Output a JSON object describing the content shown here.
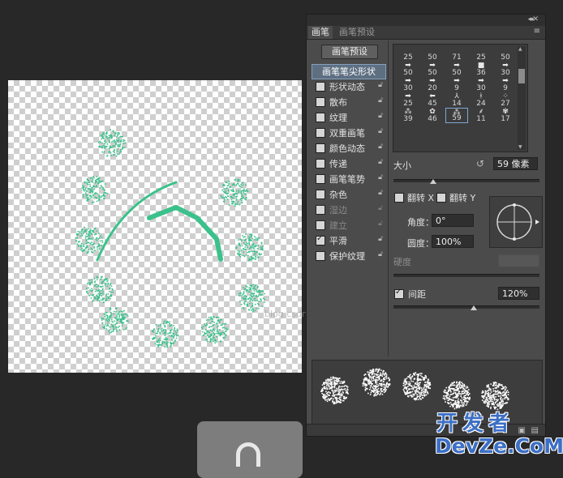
{
  "panel": {
    "tabs": [
      "画笔",
      "画笔预设"
    ],
    "brush_presets_button": "画笔预设",
    "options": [
      {
        "label": "画笔笔尖形状",
        "selected": true
      },
      {
        "label": "形状动态",
        "checked": false,
        "enabled": true
      },
      {
        "label": "散布",
        "checked": false,
        "enabled": true
      },
      {
        "label": "纹理",
        "checked": false,
        "enabled": true
      },
      {
        "label": "双重画笔",
        "checked": false,
        "enabled": true
      },
      {
        "label": "颜色动态",
        "checked": false,
        "enabled": true
      },
      {
        "label": "传递",
        "checked": false,
        "enabled": true
      },
      {
        "label": "画笔笔势",
        "checked": false,
        "enabled": true
      },
      {
        "label": "杂色",
        "checked": false,
        "enabled": true
      },
      {
        "label": "湿边",
        "checked": false,
        "enabled": false
      },
      {
        "label": "建立",
        "checked": false,
        "enabled": false
      },
      {
        "label": "平滑",
        "checked": true,
        "enabled": true
      },
      {
        "label": "保护纹理",
        "checked": false,
        "enabled": true
      }
    ],
    "brush_tips": [
      {
        "size": "25",
        "glyph": ""
      },
      {
        "size": "50",
        "glyph": ""
      },
      {
        "size": "71",
        "glyph": ""
      },
      {
        "size": "25",
        "glyph": ""
      },
      {
        "size": "50",
        "glyph": ""
      },
      {
        "size": "50",
        "glyph": "➡"
      },
      {
        "size": "50",
        "glyph": "➡"
      },
      {
        "size": "50",
        "glyph": "➡"
      },
      {
        "size": "36",
        "glyph": "■"
      },
      {
        "size": "30",
        "glyph": "➡"
      },
      {
        "size": "30",
        "glyph": "➡"
      },
      {
        "size": "20",
        "glyph": "➡"
      },
      {
        "size": "9",
        "glyph": "➡"
      },
      {
        "size": "30",
        "glyph": "➡"
      },
      {
        "size": "9",
        "glyph": "➡"
      },
      {
        "size": "25",
        "glyph": "➡"
      },
      {
        "size": "45",
        "glyph": "⬅"
      },
      {
        "size": "14",
        "glyph": "⅄"
      },
      {
        "size": "24",
        "glyph": "ᚼ"
      },
      {
        "size": "27",
        "glyph": "⁘"
      },
      {
        "size": "39",
        "glyph": "⁂"
      },
      {
        "size": "46",
        "glyph": "✿"
      },
      {
        "size": "59",
        "glyph": "⁂",
        "selected": true
      },
      {
        "size": "11",
        "glyph": "⸙"
      },
      {
        "size": "17",
        "glyph": "✾"
      }
    ],
    "size_label": "大小",
    "size_value": "59 像素",
    "flip_x": "翻转 X",
    "flip_y": "翻转 Y",
    "angle_label": "角度：",
    "angle_value": "0°",
    "roundness_label": "圆度：",
    "roundness_value": "100%",
    "hardness_label": "硬度",
    "spacing_label": "间距",
    "spacing_value": "120%",
    "spacing_checked": true,
    "size_slider_level": 0.27,
    "spacing_slider_level": 0.55
  },
  "canvas": {
    "watermark": "blog.csdn.net/wangzibgan"
  },
  "logo": {
    "line1": "开发者",
    "line2": "DevZe.CoM"
  },
  "colors": {
    "stroke": "#3bc18b",
    "panel_bg": "#4b4b4b",
    "selection": "#5e6f82",
    "logo": "#3c6fc6"
  }
}
